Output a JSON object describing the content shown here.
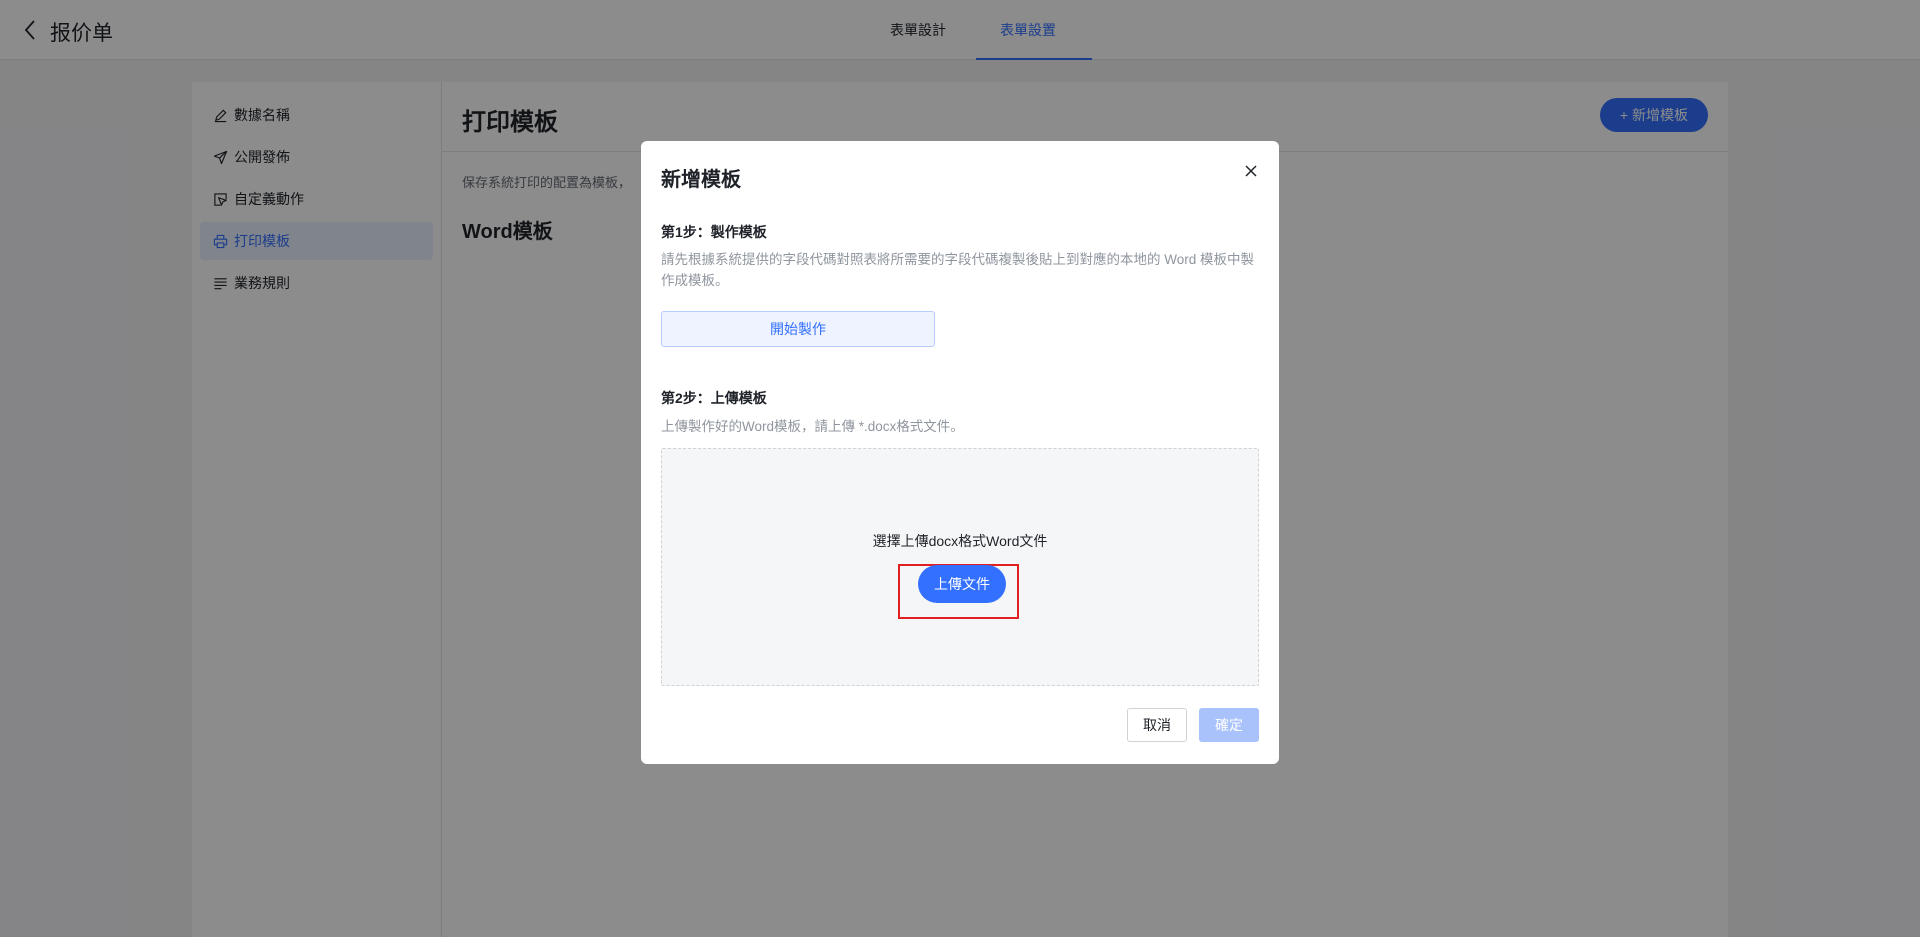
{
  "header": {
    "title": "报价单",
    "tabs": [
      {
        "label": "表單設計",
        "active": false
      },
      {
        "label": "表單設置",
        "active": true
      }
    ]
  },
  "sidebar": {
    "items": [
      {
        "label": "數據名稱",
        "icon": "pencil-icon",
        "active": false
      },
      {
        "label": "公開發佈",
        "icon": "send-icon",
        "active": false
      },
      {
        "label": "自定義動作",
        "icon": "cursor-box-icon",
        "active": false
      },
      {
        "label": "打印模板",
        "icon": "printer-icon",
        "active": true
      },
      {
        "label": "業務規則",
        "icon": "list-icon",
        "active": false
      }
    ]
  },
  "content": {
    "title": "打印模板",
    "new_button": "新增模板",
    "description": "保存系統打印的配置為模板，",
    "section_title": "Word模板"
  },
  "modal": {
    "title": "新增模板",
    "step1": {
      "title": "第1步：製作模板",
      "description": "請先根據系統提供的字段代碼對照表將所需要的字段代碼複製後貼上到對應的本地的 Word 模板中製作成模板。",
      "button": "開始製作"
    },
    "step2": {
      "title": "第2步：上傳模板",
      "description": "上傳製作好的Word模板，請上傳 *.docx格式文件。",
      "dropzone_text": "選擇上傳docx格式Word文件",
      "upload_button": "上傳文件"
    },
    "cancel": "取消",
    "confirm": "確定"
  },
  "colors": {
    "accent": "#3370ff",
    "highlight": "#e02020"
  }
}
